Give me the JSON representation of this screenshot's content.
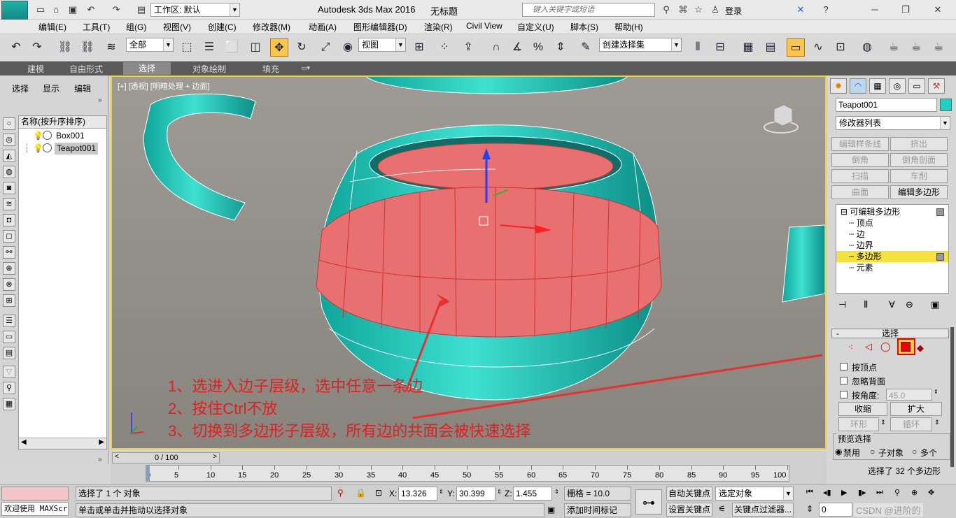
{
  "titlebar": {
    "logo": "MAX",
    "workspace": "工作区: 默认",
    "title": "Autodesk 3ds Max 2016",
    "doc": "无标题",
    "search_placeholder": "键入关键字或短语",
    "login": "登录"
  },
  "menu": [
    "编辑(E)",
    "工具(T)",
    "组(G)",
    "视图(V)",
    "创建(C)",
    "修改器(M)",
    "动画(A)",
    "图形编辑器(D)",
    "渲染(R)",
    "Civil View",
    "自定义(U)",
    "脚本(S)",
    "帮助(H)"
  ],
  "toolbar": {
    "filter": "全部",
    "refcoord": "视图",
    "selset": "创建选择集"
  },
  "ribbon": {
    "tabs": [
      "建模",
      "自由形式",
      "选择",
      "对象绘制",
      "填充"
    ]
  },
  "left": {
    "tabs": [
      "选择",
      "显示",
      "编辑"
    ],
    "header": "名称(按升序排序)",
    "items": [
      "Box001",
      "Teapot001"
    ]
  },
  "viewport": {
    "label": "[+] [透视] [明暗处理 + 边面]",
    "colors": {
      "teapot": "#20d0c0",
      "selected": "#e87070"
    }
  },
  "annotations": [
    "1、选进入边子层级，选中任意一条边",
    "2、按住Ctrl不放",
    "3、切换到多边形子层级，所有边的共面会被快速选择"
  ],
  "right": {
    "objname": "Teapot001",
    "modlist": "修改器列表",
    "buttons": [
      [
        "编辑样条线",
        "挤出"
      ],
      [
        "倒角",
        "倒角剖面"
      ],
      [
        "扫描",
        "车削"
      ],
      [
        "曲面",
        "编辑多边形"
      ]
    ],
    "stack": [
      {
        "label": "可编辑多边形"
      },
      {
        "label": "顶点"
      },
      {
        "label": "边"
      },
      {
        "label": "边界"
      },
      {
        "label": "多边形"
      },
      {
        "label": "元素"
      }
    ],
    "rollout": "选择",
    "checks": [
      "按顶点",
      "忽略背面",
      "按角度:"
    ],
    "angle": "45.0",
    "shrink": "收缩",
    "grow": "扩大",
    "ring": "环形",
    "loop": "循环",
    "preview": "预览选择",
    "preview_opts": [
      "禁用",
      "子对象",
      "多个"
    ],
    "status": "选择了 32 个多边形"
  },
  "timeline": {
    "frame": "0 / 100",
    "ticks": [
      "0",
      "5",
      "10",
      "15",
      "20",
      "25",
      "30",
      "35",
      "40",
      "45",
      "50",
      "55",
      "60",
      "65",
      "70",
      "75",
      "80",
      "85",
      "90",
      "95",
      "100"
    ]
  },
  "status": {
    "welcome": "欢迎使用 MAXScr",
    "selected": "选择了 1 个 对象",
    "hint": "单击或单击并拖动以选择对象",
    "x_label": "X:",
    "x": "13.326",
    "y_label": "Y:",
    "y": "30.399",
    "z_label": "Z:",
    "z": "1.455",
    "grid": "栅格 = 10.0",
    "autokey": "自动关键点",
    "setkey": "设置关键点",
    "selobj": "选定对象",
    "keyfilter": "关键点过滤器...",
    "addtime": "添加时间标记",
    "frame_spin": "0",
    "watermark": "CSDN @进阶的"
  }
}
